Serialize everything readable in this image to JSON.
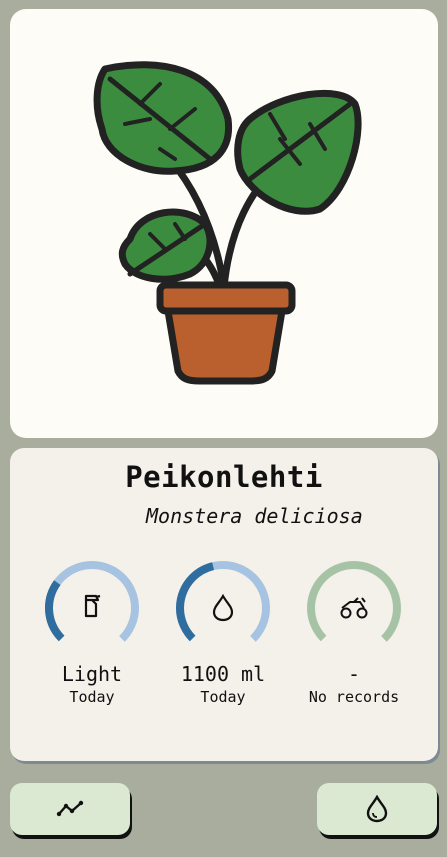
{
  "plant": {
    "name": "Peikonlehti",
    "latin_name": "Monstera deliciosa",
    "image_icon": "monstera-plant-illustration"
  },
  "stats": [
    {
      "icon": "spray-bottle-icon",
      "value": "Light",
      "sub": "Today",
      "fill_fraction": 0.3,
      "ring_color": "#a7c3e2",
      "fill_color": "#2f6d9e"
    },
    {
      "icon": "water-drop-icon",
      "value": "1100 ml",
      "sub": "Today",
      "fill_fraction": 0.45,
      "ring_color": "#a7c3e2",
      "fill_color": "#2f6d9e"
    },
    {
      "icon": "tractor-icon",
      "value": "-",
      "sub": "No records",
      "fill_fraction": 0,
      "ring_color": "#a6c4a5",
      "fill_color": "#5d8f5b"
    }
  ],
  "buttons": {
    "history_icon": "line-chart-icon",
    "water_icon": "water-drop-icon"
  },
  "colors": {
    "background": "#a9ad9d",
    "card": "#f4f0ea",
    "button": "#dbe9d3",
    "leaf": "#3c8c3f",
    "pot": "#b9602e"
  }
}
